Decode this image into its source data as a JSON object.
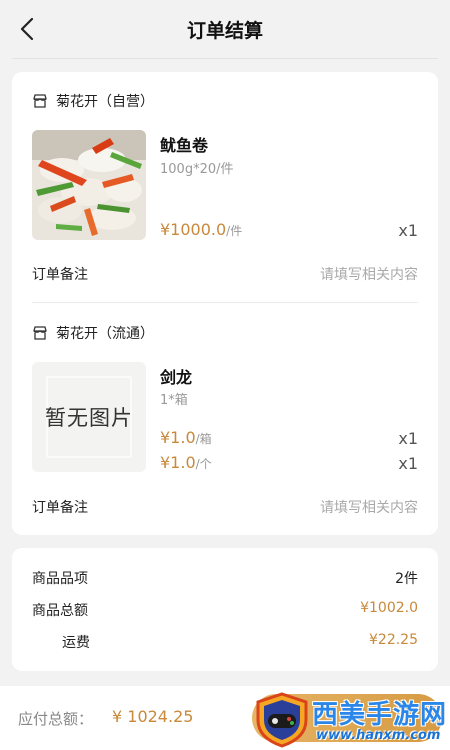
{
  "header": {
    "title": "订单结算"
  },
  "orders": [
    {
      "store": "菊花开（自营）",
      "product": {
        "name": "鱿鱼卷",
        "spec": "100g*20/件",
        "prices": [
          {
            "price": "¥1000.0",
            "unit": "/件",
            "qty": "x1"
          }
        ]
      },
      "remark": {
        "label": "订单备注",
        "placeholder": "请填写相关内容"
      }
    },
    {
      "store": "菊花开（流通）",
      "product": {
        "name": "剑龙",
        "spec": "1*箱",
        "image_placeholder": "暂无图片",
        "prices": [
          {
            "price": "¥1.0",
            "unit": "/箱",
            "qty": "x1"
          },
          {
            "price": "¥1.0",
            "unit": "/个",
            "qty": "x1"
          }
        ]
      },
      "remark": {
        "label": "订单备注",
        "placeholder": "请填写相关内容"
      }
    }
  ],
  "summary": [
    {
      "label": "商品品项",
      "value": "2件",
      "color": "#222222"
    },
    {
      "label": "商品总额",
      "value": "¥1002.0",
      "color": "#c8893a"
    },
    {
      "label": "运费",
      "value": "¥22.25",
      "color": "#c8893a"
    }
  ],
  "footer": {
    "total_label": "应付总额：",
    "total_value": "¥ 1024.25"
  },
  "watermark": {
    "text": "西美手游网",
    "url": "www.hanxm.com"
  },
  "colors": {
    "accent": "#c8893a",
    "button": "#d69a42"
  }
}
